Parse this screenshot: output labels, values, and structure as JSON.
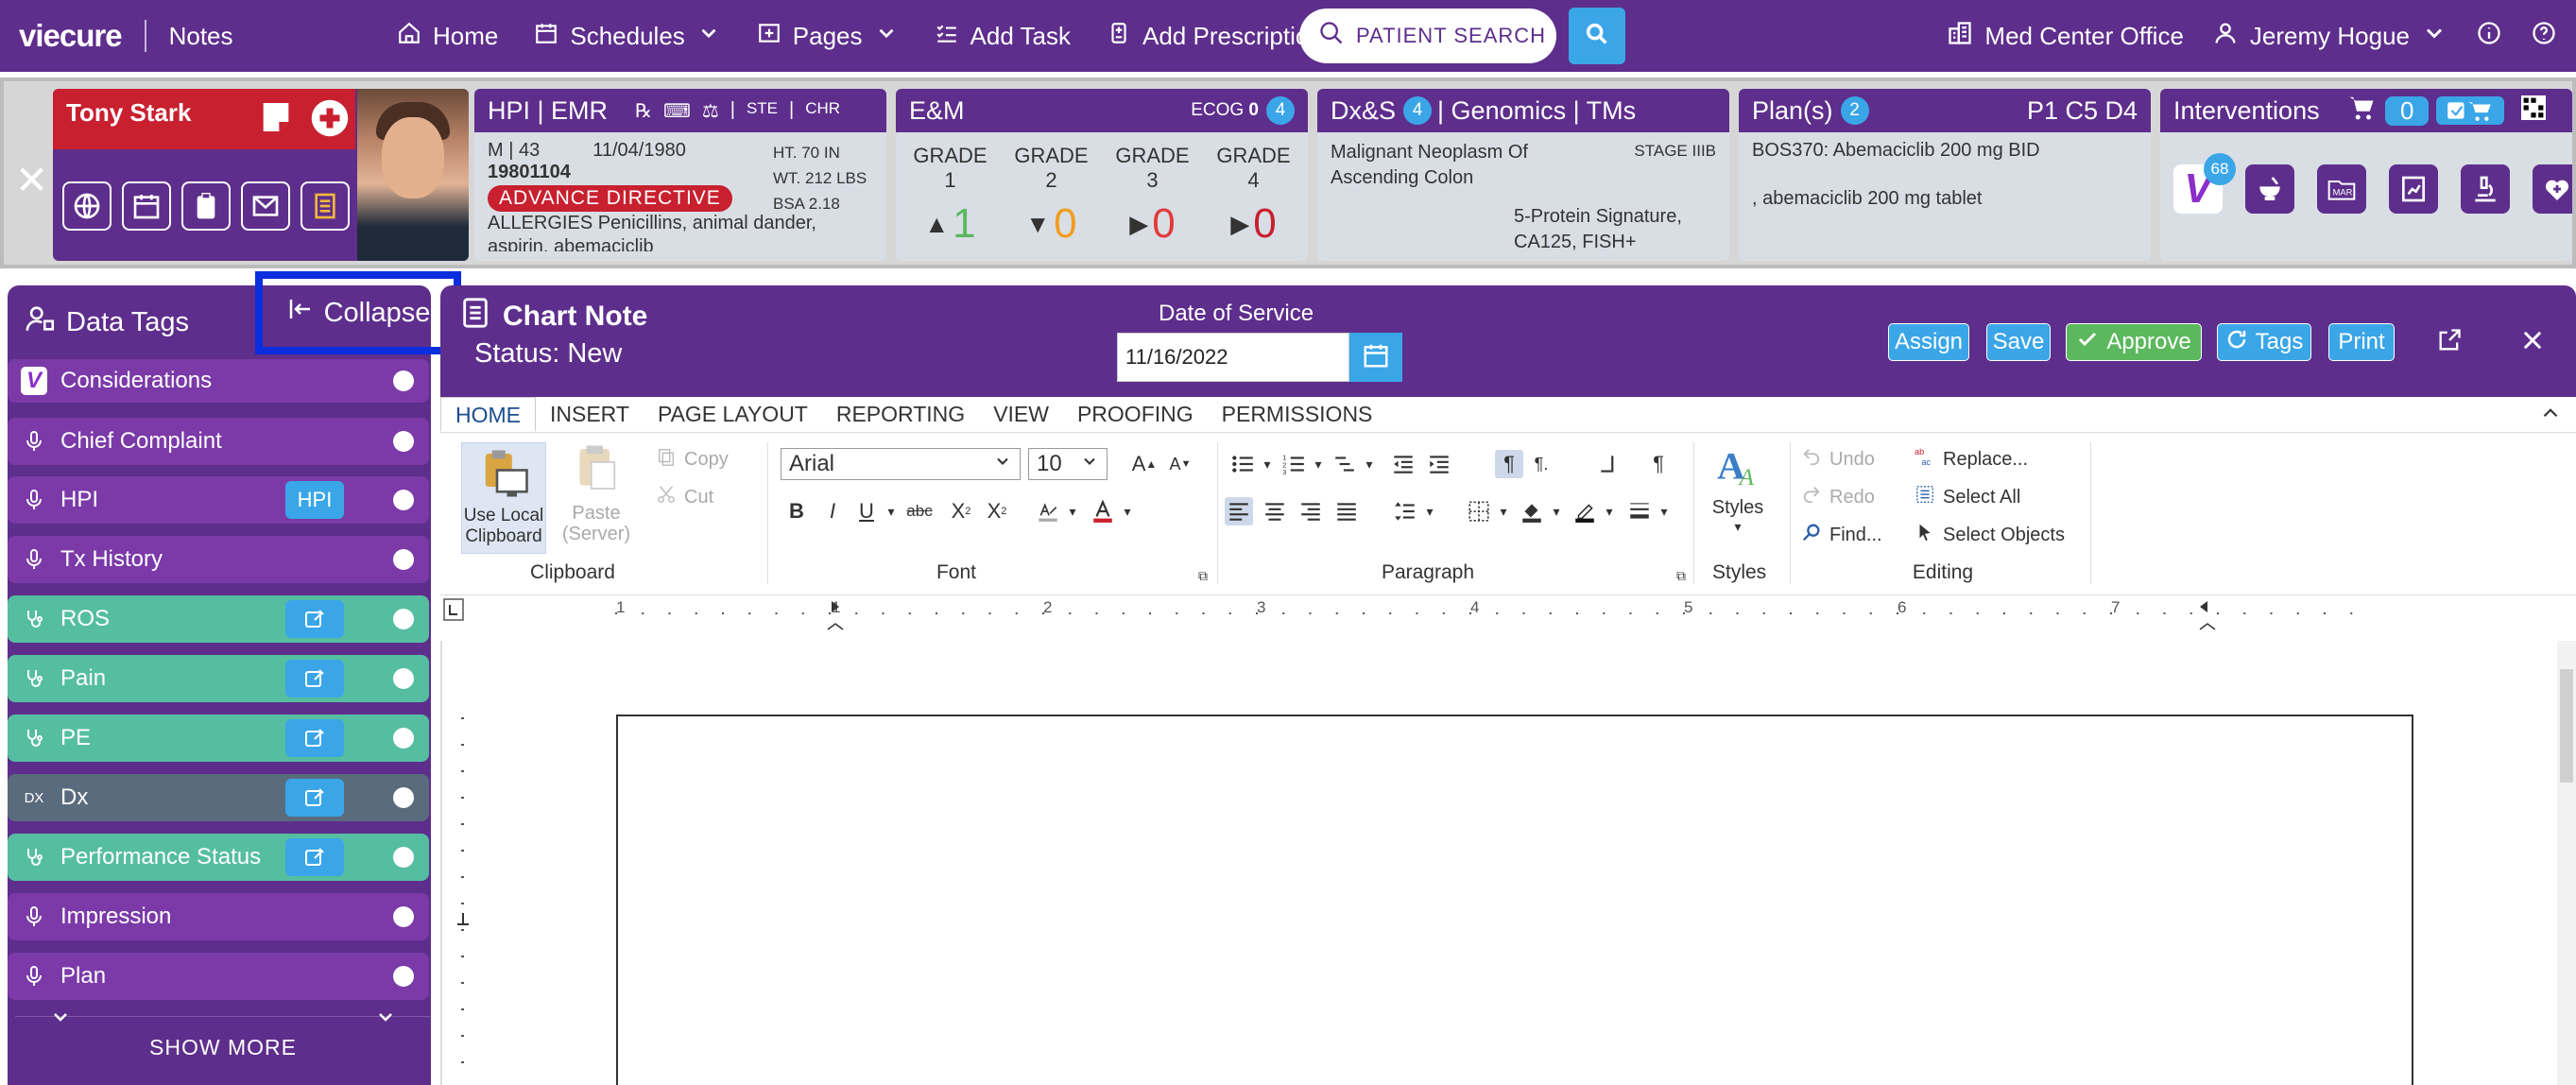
{
  "topbar": {
    "logo": "viecure",
    "app_name": "Notes",
    "nav": [
      {
        "label": "Home",
        "icon": "home-icon"
      },
      {
        "label": "Schedules",
        "icon": "calendar-icon"
      },
      {
        "label": "Pages",
        "icon": "pages-icon"
      },
      {
        "label": "Add Task",
        "icon": "task-list-icon"
      },
      {
        "label": "Add Prescription",
        "icon": "prescription-icon"
      }
    ],
    "search_placeholder": "PATIENT SEARCH",
    "office": "Med Center Office",
    "user": "Jeremy Hogue"
  },
  "patient": {
    "name": "Tony Stark",
    "hpi": {
      "title": "HPI | EMR",
      "tags": [
        "STE",
        "CHR"
      ],
      "sex_age": "M | 43",
      "dob": "11/04/1980",
      "mrn": "19801104",
      "height": "HT. 70 IN",
      "weight": "WT. 212 LBS",
      "bsa": "BSA 2.18",
      "advance_directive": "ADVANCE DIRECTIVE",
      "allergies": "ALLERGIES Penicillins, animal dander, aspirin, abemaciclib"
    },
    "em": {
      "title": "E&M",
      "ecog_label": "ECOG",
      "ecog_value": "0",
      "badge": "4",
      "grades": [
        {
          "label": "GRADE 1",
          "value": "1",
          "color": "#5bb85d"
        },
        {
          "label": "GRADE 2",
          "value": "0",
          "color": "#f29c1f"
        },
        {
          "label": "GRADE 3",
          "value": "0",
          "color": "#e23b3b"
        },
        {
          "label": "GRADE 4",
          "value": "0",
          "color": "#c8202f"
        }
      ]
    },
    "dx": {
      "title_a": "Dx&S",
      "badge": "4",
      "title_b": "| Genomics | TMs",
      "diagnosis": "Malignant Neoplasm Of Ascending Colon",
      "stage": "STAGE IIIB",
      "genomics": "5-Protein Signature, CA125, FISH+"
    },
    "plans": {
      "title": "Plan(s)",
      "badge": "2",
      "cycle": "P1 C5 D4",
      "line1": "BOS370: Abemaciclib 200 mg BID",
      "line2": ", abemaciclib 200 mg tablet"
    },
    "interventions": {
      "title": "Interventions",
      "cart_count": "0",
      "v_badge": "68",
      "mar_label": "MAR"
    }
  },
  "data_tags": {
    "title": "Data Tags",
    "collapse_label": "Collapse",
    "items": [
      {
        "label": "Considerations",
        "style": "purple",
        "icon": "v"
      },
      {
        "label": "Chief Complaint",
        "style": "purple",
        "icon": "mic"
      },
      {
        "label": "HPI",
        "style": "purple",
        "icon": "mic",
        "button": "HPI"
      },
      {
        "label": "Tx History",
        "style": "purple",
        "icon": "mic"
      },
      {
        "label": "ROS",
        "style": "teal",
        "icon": "stetho",
        "button": "edit"
      },
      {
        "label": "Pain",
        "style": "teal",
        "icon": "stetho",
        "button": "edit"
      },
      {
        "label": "PE",
        "style": "teal",
        "icon": "stetho",
        "button": "edit"
      },
      {
        "label": "Dx",
        "style": "slate",
        "icon": "dx",
        "button": "edit"
      },
      {
        "label": "Performance Status",
        "style": "teal",
        "icon": "stetho",
        "button": "edit"
      },
      {
        "label": "Impression",
        "style": "purple",
        "icon": "mic"
      },
      {
        "label": "Plan",
        "style": "purple",
        "icon": "mic"
      }
    ],
    "show_more": "SHOW MORE"
  },
  "chart_note": {
    "title": "Chart Note",
    "status": "Status: New",
    "dos_label": "Date of Service",
    "dos_value": "11/16/2022",
    "buttons": {
      "assign": "Assign",
      "save": "Save",
      "approve": "Approve",
      "tags": "Tags",
      "print": "Print"
    }
  },
  "ribbon": {
    "tabs": [
      "HOME",
      "INSERT",
      "PAGE LAYOUT",
      "REPORTING",
      "VIEW",
      "PROOFING",
      "PERMISSIONS"
    ],
    "active_tab": "HOME",
    "clipboard": {
      "use_local": "Use Local Clipboard",
      "paste": "Paste (Server)",
      "copy": "Copy",
      "cut": "Cut",
      "label": "Clipboard"
    },
    "font": {
      "family": "Arial",
      "size": "10",
      "label": "Font"
    },
    "paragraph": {
      "label": "Paragraph"
    },
    "styles": {
      "button": "Styles",
      "label": "Styles"
    },
    "editing": {
      "undo": "Undo",
      "redo": "Redo",
      "find": "Find...",
      "replace": "Replace...",
      "select_all": "Select All",
      "select_objects": "Select Objects",
      "label": "Editing"
    }
  },
  "ruler": {
    "marks": [
      "1",
      "1",
      "2",
      "3",
      "4",
      "5",
      "6",
      "7"
    ]
  }
}
